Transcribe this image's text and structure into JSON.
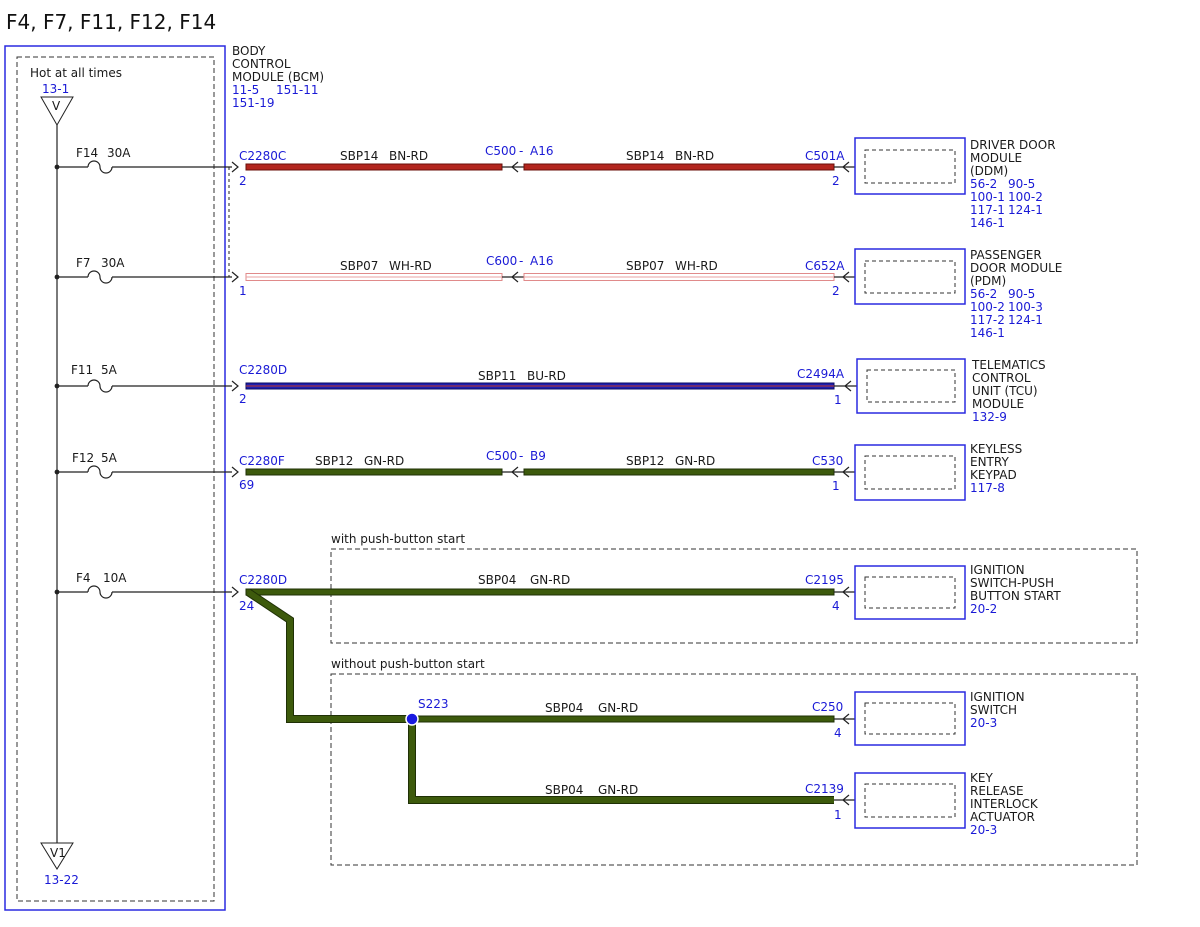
{
  "title": "F4, F7, F11, F12, F14",
  "colors": {
    "blue": "#1a1ad6",
    "bn_rd": "#b3261e",
    "gn_rd": "#3d5a0c",
    "bu_rd": "#1f1fb0",
    "wh_rd": "#e8a0a0"
  },
  "bcm": {
    "l1": "BODY",
    "l2": "CONTROL",
    "l3": "MODULE (BCM)",
    "r1a": "11-5",
    "r1b": "151-11",
    "r2": "151-19"
  },
  "hot": "Hot at all times",
  "top_ref": "13-1",
  "top_v": "V",
  "bottom_v": "V1",
  "bottom_ref": "13-22",
  "fuses": [
    {
      "name": "F14",
      "amp": "30A"
    },
    {
      "name": "F7",
      "amp": "30A"
    },
    {
      "name": "F11",
      "amp": "5A"
    },
    {
      "name": "F12",
      "amp": "5A"
    },
    {
      "name": "F4",
      "amp": "10A"
    }
  ],
  "circuits": {
    "r1": {
      "conn": "C2280C",
      "pin": "2",
      "wire": "SBP14",
      "color": "BN-RD",
      "inline": "C500",
      "inline_pin": "A16",
      "wire2": "SBP14",
      "color2": "BN-RD",
      "dest_conn": "C501A",
      "dest_pin": "2"
    },
    "r2": {
      "conn": "",
      "pin": "1",
      "wire": "SBP07",
      "color": "WH-RD",
      "inline": "C600",
      "inline_pin": "A16",
      "wire2": "SBP07",
      "color2": "WH-RD",
      "dest_conn": "C652A",
      "dest_pin": "2"
    },
    "r3": {
      "conn": "C2280D",
      "pin": "2",
      "wire": "SBP11",
      "color": "BU-RD",
      "dest_conn": "C2494A",
      "dest_pin": "1"
    },
    "r4": {
      "conn": "C2280F",
      "pin": "69",
      "wire": "SBP12",
      "color": "GN-RD",
      "inline": "C500",
      "inline_pin": "B9",
      "wire2": "SBP12",
      "color2": "GN-RD",
      "dest_conn": "C530",
      "dest_pin": "1"
    },
    "r5": {
      "conn": "C2280D",
      "pin": "24",
      "wire": "SBP04",
      "color": "GN-RD",
      "dest_conn": "C2195",
      "dest_pin": "4"
    },
    "r6": {
      "splice": "S223",
      "wire": "SBP04",
      "color": "GN-RD",
      "dest_conn": "C250",
      "dest_pin": "4"
    },
    "r7": {
      "wire": "SBP04",
      "color": "GN-RD",
      "dest_conn": "C2139",
      "dest_pin": "1"
    }
  },
  "groups": {
    "push": "with push-button start",
    "nopush": "without push-button start"
  },
  "modules": {
    "ddm": {
      "l1": "DRIVER DOOR",
      "l2": "MODULE",
      "l3": "(DDM)",
      "refs": [
        "56-2",
        "90-5",
        "100-1",
        "100-2",
        "117-1",
        "124-1",
        "146-1"
      ]
    },
    "pdm": {
      "l1": "PASSENGER",
      "l2": "DOOR MODULE",
      "l3": "(PDM)",
      "refs": [
        "56-2",
        "90-5",
        "100-2",
        "100-3",
        "117-2",
        "124-1",
        "146-1"
      ]
    },
    "tcu": {
      "l1": "TELEMATICS",
      "l2": "CONTROL",
      "l3": "UNIT (TCU)",
      "l4": "MODULE",
      "ref": "132-9"
    },
    "kek": {
      "l1": "KEYLESS",
      "l2": "ENTRY",
      "l3": "KEYPAD",
      "ref": "117-8"
    },
    "isp": {
      "l1": "IGNITION",
      "l2": "SWITCH-PUSH",
      "l3": "BUTTON START",
      "ref": "20-2"
    },
    "ign": {
      "l1": "IGNITION",
      "l2": "SWITCH",
      "ref": "20-3"
    },
    "kri": {
      "l1": "KEY",
      "l2": "RELEASE",
      "l3": "INTERLOCK",
      "l4": "ACTUATOR",
      "ref": "20-3"
    }
  }
}
